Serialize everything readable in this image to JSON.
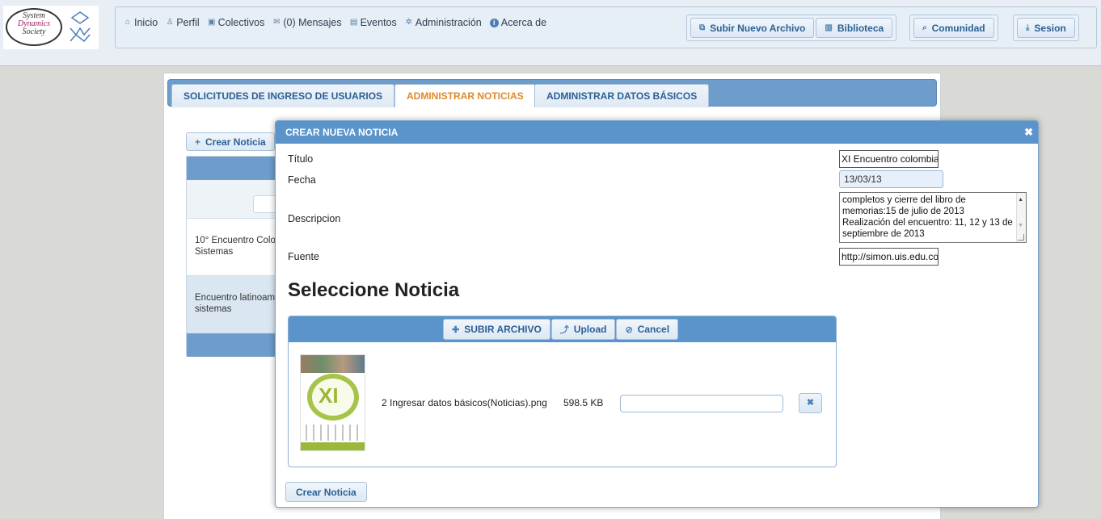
{
  "header": {
    "logo": {
      "line1": "System",
      "line2": "Dynamics",
      "line3": "Society"
    },
    "menu": [
      {
        "label": "Inicio",
        "icon": "home-icon"
      },
      {
        "label": "Perfil",
        "icon": "user-icon"
      },
      {
        "label": "Colectivos",
        "icon": "group-icon"
      },
      {
        "label": "(0) Mensajes",
        "icon": "mail-icon"
      },
      {
        "label": "Eventos",
        "icon": "calendar-icon"
      },
      {
        "label": "Administración",
        "icon": "gear-icon"
      },
      {
        "label": "Acerca de",
        "icon": "info-icon"
      }
    ],
    "toolbar": {
      "subir": "Subir Nuevo Archivo",
      "biblioteca": "Biblioteca",
      "comunidad": "Comunidad",
      "sesion": "Sesion"
    }
  },
  "tabs": [
    {
      "label": "SOLICITUDES DE INGRESO DE USUARIOS",
      "active": false
    },
    {
      "label": "ADMINISTRAR NOTICIAS",
      "active": true
    },
    {
      "label": "ADMINISTRAR DATOS BÁSICOS",
      "active": false
    }
  ],
  "background": {
    "crear_label": "Crear Noticia",
    "rows": [
      {
        "line1": "10° Encuentro Colo",
        "line2": "Sistemas"
      },
      {
        "line1": "Encuentro latinoam",
        "line2": "sistemas"
      }
    ]
  },
  "dialog": {
    "title": "CREAR NUEVA NOTICIA",
    "close": "✖",
    "fields": {
      "titulo_label": "Título",
      "titulo_value": "XI Encuentro colombia",
      "fecha_label": "Fecha",
      "fecha_value": "13/03/13",
      "descripcion_label": "Descripcion",
      "descripcion_value": "completos y cierre del libro de memorias:15 de julio de 2013\nRealización del encuentro: 11, 12 y 13 de septiembre de 2013",
      "fuente_label": "Fuente",
      "fuente_value": "http://simon.uis.edu.co"
    },
    "select_title": "Seleccione Noticia",
    "upload": {
      "subir": "SUBIR ARCHIVO",
      "upload": "Upload",
      "cancel": "Cancel",
      "file_name": "2 Ingresar datos básicos(Noticias).png",
      "file_size": "598.5 KB",
      "thumbnail_text": "XI"
    },
    "crear_button": "Crear Noticia"
  },
  "colors": {
    "accent_blue": "#5a94cb",
    "active_tab": "#e08a28",
    "button_text": "#2c5f94"
  }
}
